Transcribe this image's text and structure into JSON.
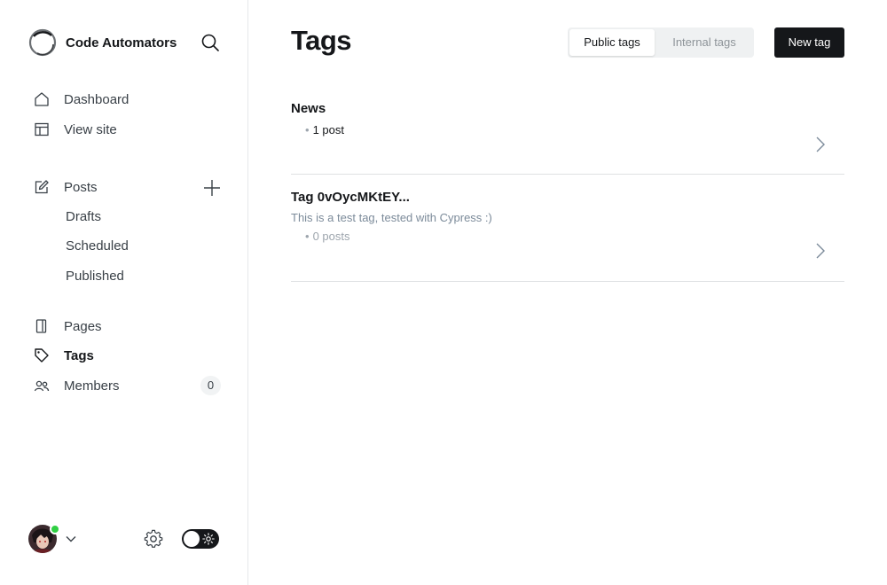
{
  "brand": {
    "name": "Code Automators"
  },
  "nav": {
    "dashboard": "Dashboard",
    "view_site": "View site",
    "posts": "Posts",
    "drafts": "Drafts",
    "scheduled": "Scheduled",
    "published": "Published",
    "pages": "Pages",
    "tags": "Tags",
    "members": "Members",
    "members_count": "0"
  },
  "page": {
    "title": "Tags",
    "filter_public": "Public tags",
    "filter_internal": "Internal tags",
    "new_tag": "New tag"
  },
  "tags": [
    {
      "name": "News",
      "description": "",
      "count": "1 post"
    },
    {
      "name": "Tag 0vOycMKtEY...",
      "description": "This is a test tag, tested with Cypress :)",
      "count": "0 posts"
    }
  ],
  "colors": {
    "accent": "#15171a",
    "online": "#30cf43",
    "muted": "#7c8b9a"
  }
}
